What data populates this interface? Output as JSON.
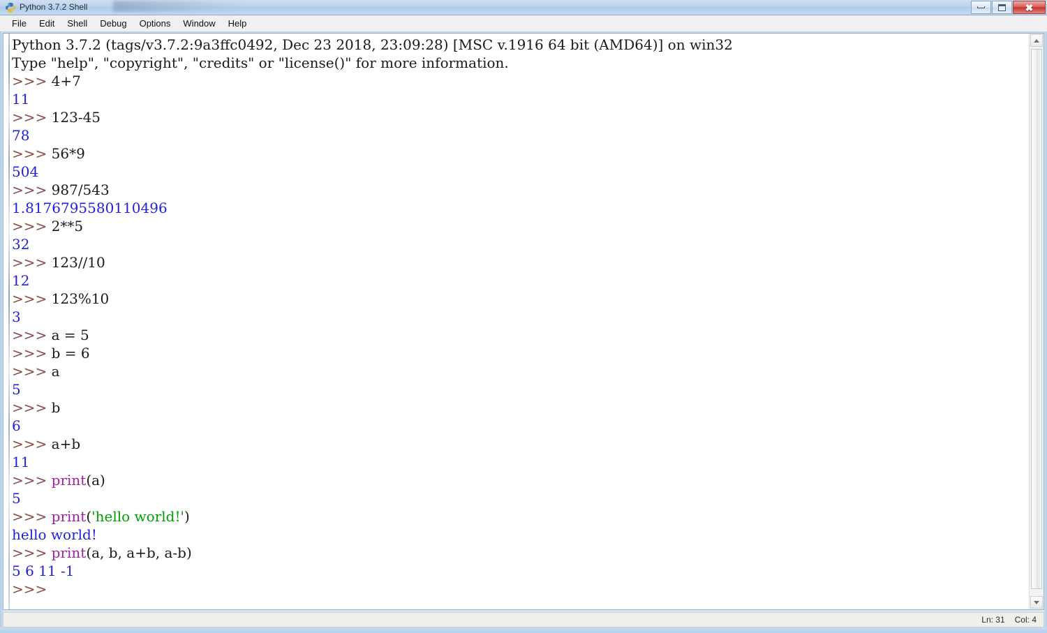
{
  "window": {
    "title": "Python 3.7.2 Shell",
    "icon": "python-logo-icon",
    "controls": {
      "minimize_label": "–",
      "maximize_label": "□",
      "close_label": "✕"
    }
  },
  "menubar": {
    "items": [
      {
        "label": "File"
      },
      {
        "label": "Edit"
      },
      {
        "label": "Shell"
      },
      {
        "label": "Debug"
      },
      {
        "label": "Options"
      },
      {
        "label": "Window"
      },
      {
        "label": "Help"
      }
    ]
  },
  "shell": {
    "banner": [
      "Python 3.7.2 (tags/v3.7.2:9a3ffc0492, Dec 23 2018, 23:09:28) [MSC v.1916 64 bit (AMD64)] on win32",
      "Type \"help\", \"copyright\", \"credits\" or \"license()\" for more information."
    ],
    "prompt": ">>> ",
    "lines": [
      {
        "kind": "input",
        "code": "4+7"
      },
      {
        "kind": "output",
        "text": "11"
      },
      {
        "kind": "input",
        "code": "123-45"
      },
      {
        "kind": "output",
        "text": "78"
      },
      {
        "kind": "input",
        "code": "56*9"
      },
      {
        "kind": "output",
        "text": "504"
      },
      {
        "kind": "input",
        "code": "987/543"
      },
      {
        "kind": "output",
        "text": "1.8176795580110496"
      },
      {
        "kind": "input",
        "code": "2**5"
      },
      {
        "kind": "output",
        "text": "32"
      },
      {
        "kind": "input",
        "code": "123//10"
      },
      {
        "kind": "output",
        "text": "12"
      },
      {
        "kind": "input",
        "code": "123%10"
      },
      {
        "kind": "output",
        "text": "3"
      },
      {
        "kind": "input",
        "code": "a = 5"
      },
      {
        "kind": "input",
        "code": "b = 6"
      },
      {
        "kind": "input",
        "code": "a"
      },
      {
        "kind": "output",
        "text": "5"
      },
      {
        "kind": "input",
        "code": "b"
      },
      {
        "kind": "output",
        "text": "6"
      },
      {
        "kind": "input",
        "code": "a+b"
      },
      {
        "kind": "output",
        "text": "11"
      },
      {
        "kind": "input",
        "keyword": "print",
        "code": "(a)"
      },
      {
        "kind": "output",
        "text": "5"
      },
      {
        "kind": "input",
        "keyword": "print",
        "code": "(",
        "string": "'hello world!'",
        "code_after": ")"
      },
      {
        "kind": "output",
        "text": "hello world!"
      },
      {
        "kind": "input",
        "keyword": "print",
        "code": "(a, b, a+b, a-b)"
      },
      {
        "kind": "output",
        "text": "5 6 11 -1"
      },
      {
        "kind": "input",
        "code": ""
      }
    ]
  },
  "statusbar": {
    "line_label": "Ln: 31",
    "col_label": "Col: 4"
  },
  "scrollbar": {
    "up_arrow": "scroll-up-arrow-icon",
    "down_arrow": "scroll-down-arrow-icon"
  },
  "colors": {
    "prompt": "#8b4a4a",
    "output": "#2020dd",
    "keyword": "#a020a0",
    "string": "#00a000",
    "code": "#1a1a1a"
  }
}
